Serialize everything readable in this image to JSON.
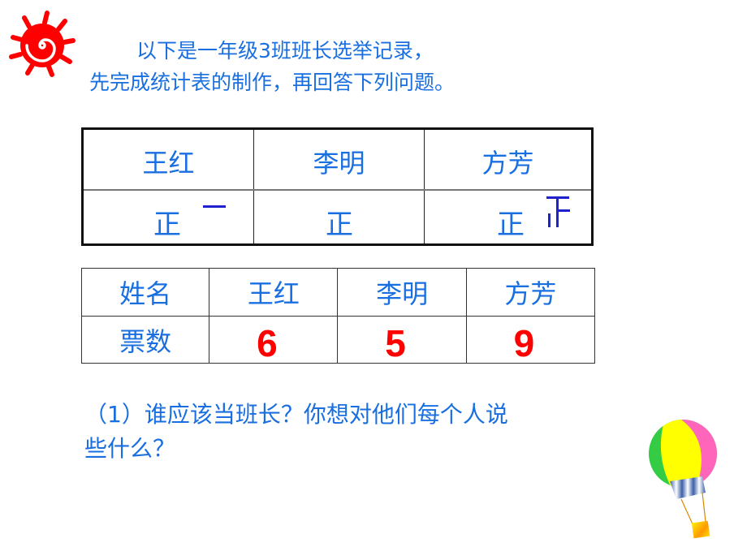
{
  "decorations": {
    "sun_icon": "sun-spiral-icon",
    "balloon_icon": "hot-air-balloon-icon",
    "sun_color": "#ff0000"
  },
  "intro": {
    "line1": "以下是一年级3班班长选举记录，",
    "line2": "先完成统计表的制作，再回答下列问题。"
  },
  "tally_table": {
    "candidates": [
      "王红",
      "李明",
      "方芳"
    ],
    "tally_marks": [
      {
        "base": "正",
        "extra_strokes": 1
      },
      {
        "base": "正",
        "extra_strokes": 0
      },
      {
        "base": "正",
        "extra_strokes": 4
      }
    ]
  },
  "count_table": {
    "header_label": "姓名",
    "row_label": "票数",
    "names": [
      "王红",
      "李明",
      "方芳"
    ],
    "votes": [
      "6",
      "5",
      "9"
    ]
  },
  "question": {
    "line1": "（1）谁应该当班长？你想对他们每个人说",
    "line2": "些什么？"
  },
  "colors": {
    "text_blue": "#1a6fe0",
    "vote_red": "#ff0000",
    "stroke_blue": "#2020cc"
  }
}
